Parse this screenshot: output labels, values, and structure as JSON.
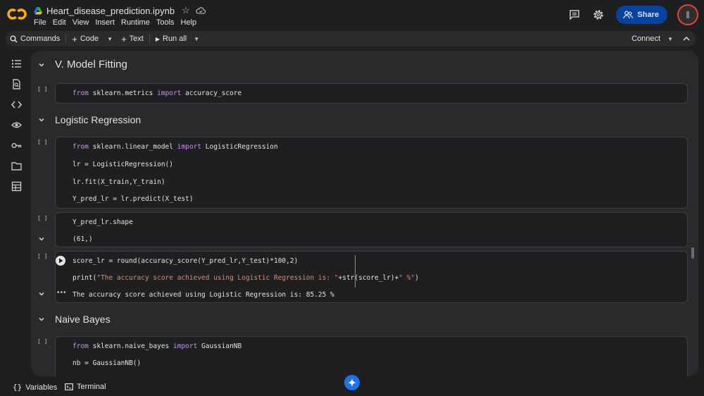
{
  "app": {
    "notebook_title": "Heart_disease_prediction.ipynb",
    "menu": [
      "File",
      "Edit",
      "View",
      "Insert",
      "Runtime",
      "Tools",
      "Help"
    ],
    "share_label": "Share",
    "brand_color": "#f9ab00"
  },
  "toolbar": {
    "commands_label": "Commands",
    "code_label": "Code",
    "text_label": "Text",
    "run_all_label": "Run all",
    "connect_label": "Connect"
  },
  "rail_icons": [
    "table-of-contents-icon",
    "find-icon",
    "code-snippets-icon",
    "variables-inspector-icon",
    "secrets-key-icon",
    "files-folder-icon",
    "data-table-icon"
  ],
  "sections": {
    "model_fitting": "V. Model Fitting",
    "logistic_regression": "Logistic Regression",
    "naive_bayes": "Naive Bayes"
  },
  "cells": {
    "bracket": "[ ]",
    "c1": {
      "kw_from": "from",
      "mod": " sklearn.metrics ",
      "kw_import": "import",
      "name": " accuracy_score"
    },
    "c2": {
      "l1_kw_from": "from",
      "l1_mod": " sklearn.linear_model ",
      "l1_kw_import": "import",
      "l1_name": " LogisticRegression",
      "l2": "lr = LogisticRegression()",
      "l3": "lr.fit(X_train,Y_train)",
      "l4": "Y_pred_lr = lr.predict(X_test)"
    },
    "c3": {
      "code": "Y_pred_lr.shape",
      "output": "(61,)"
    },
    "c4": {
      "l1": "score_lr = round(accuracy_score(Y_pred_lr,Y_test)*100,2)",
      "l2_fn": "print(",
      "l2_str": "\"The accuracy score achieved using Logistic Regression is: \"",
      "l2_mid": "+str(score_lr)+",
      "l2_str2": "\" %\"",
      "l2_end": ")",
      "output": "The accuracy score achieved using Logistic Regression is: 85.25 %"
    },
    "c5": {
      "l1_kw_from": "from",
      "l1_mod": " sklearn.naive_bayes ",
      "l1_kw_import": "import",
      "l1_name": " GaussianNB",
      "l2": "nb = GaussianNB()"
    }
  },
  "bottom": {
    "variables_label": "Variables",
    "terminal_label": "Terminal"
  }
}
